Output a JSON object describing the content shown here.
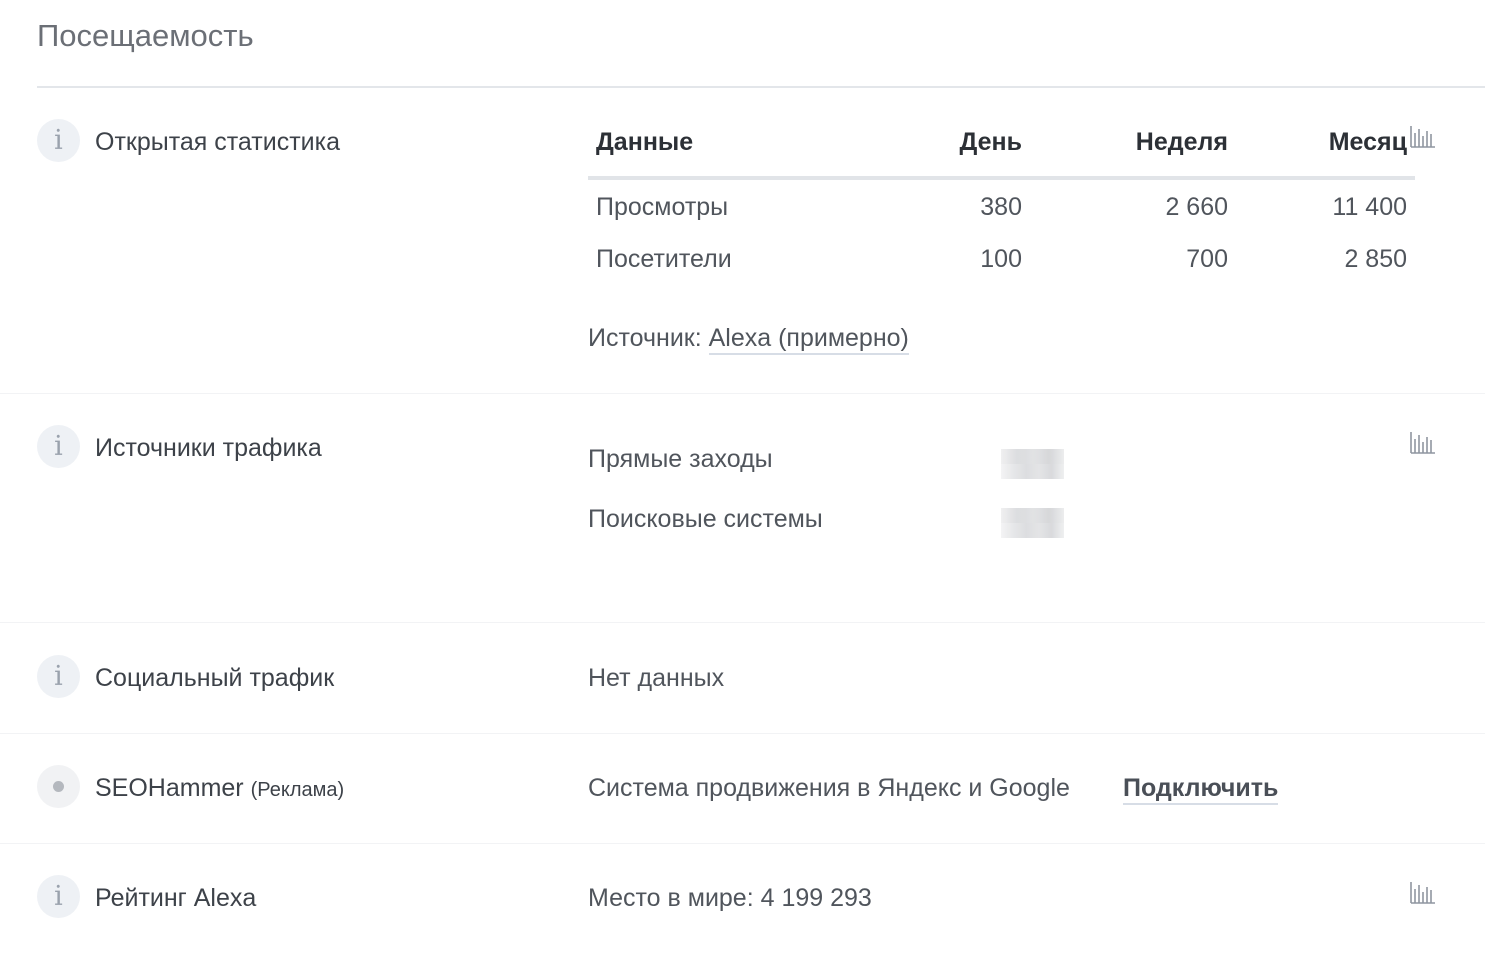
{
  "page": {
    "title": "Посещаемость"
  },
  "open_stats": {
    "label": "Открытая статистика",
    "table": {
      "headers": [
        "Данные",
        "День",
        "Неделя",
        "Месяц"
      ],
      "rows": [
        [
          "Просмотры",
          "380",
          "2 660",
          "11 400"
        ],
        [
          "Посетители",
          "100",
          "700",
          "2 850"
        ]
      ]
    },
    "source_prefix": "Источник:",
    "source_link": "Alexa (примерно)"
  },
  "traffic_sources": {
    "label": "Источники трафика",
    "items": [
      {
        "label": "Прямые заходы"
      },
      {
        "label": "Поисковые системы"
      }
    ]
  },
  "social_traffic": {
    "label": "Социальный трафик",
    "value": "Нет данных"
  },
  "seohammer": {
    "label": "SEOHammer",
    "ad_note": "(Реклама)",
    "description": "Система продвижения в Яндекс и Google",
    "action": "Подключить"
  },
  "alexa_rank": {
    "label": "Рейтинг Alexa",
    "value": "Место в мире: 4 199 293"
  },
  "icons": {
    "info": "info-icon",
    "chart": "bar-chart-icon",
    "ad": "dot-icon"
  },
  "colors": {
    "text": "#4a4f57",
    "heading": "#2c3036",
    "icon_bg": "#eef1f5",
    "divider": "#e3e6ea"
  }
}
